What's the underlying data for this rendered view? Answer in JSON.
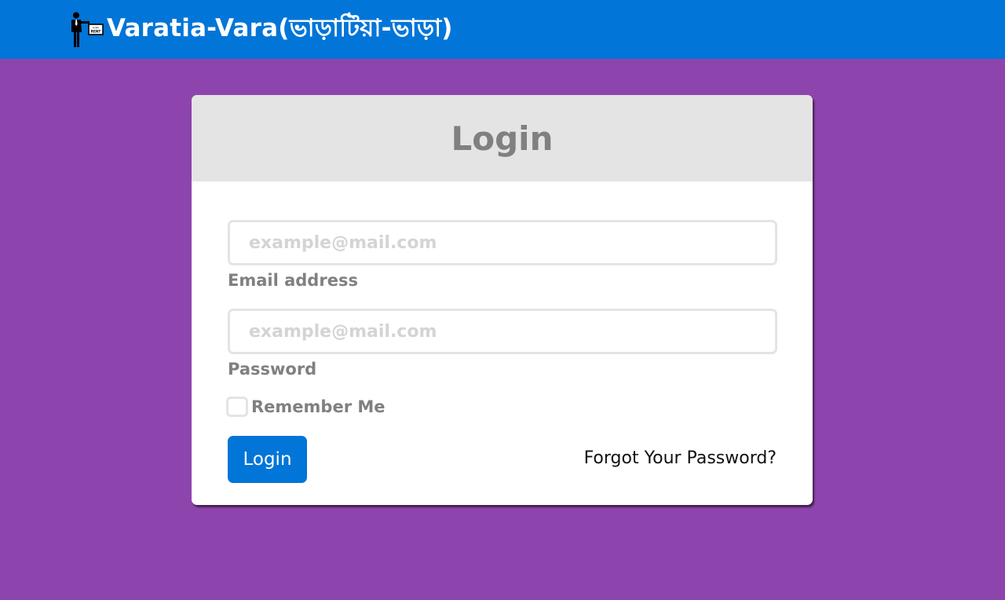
{
  "navbar": {
    "brand_text": "Varatia-Vara(ভাড়াটিয়া-ভাড়া)",
    "logo_icon": "man-with-for-rent-sign-icon",
    "logo_sign_text": "FOR RENT",
    "background_color": "#0275d8"
  },
  "page": {
    "background_color": "#8e44ad"
  },
  "login_card": {
    "title": "Login",
    "email": {
      "placeholder": "example@mail.com",
      "value": "",
      "label": "Email address"
    },
    "password": {
      "placeholder": "example@mail.com",
      "value": "",
      "label": "Password"
    },
    "remember_me": {
      "label": "Remember Me",
      "checked": false
    },
    "submit_label": "Login",
    "forgot_password_label": "Forgot Your Password?"
  }
}
